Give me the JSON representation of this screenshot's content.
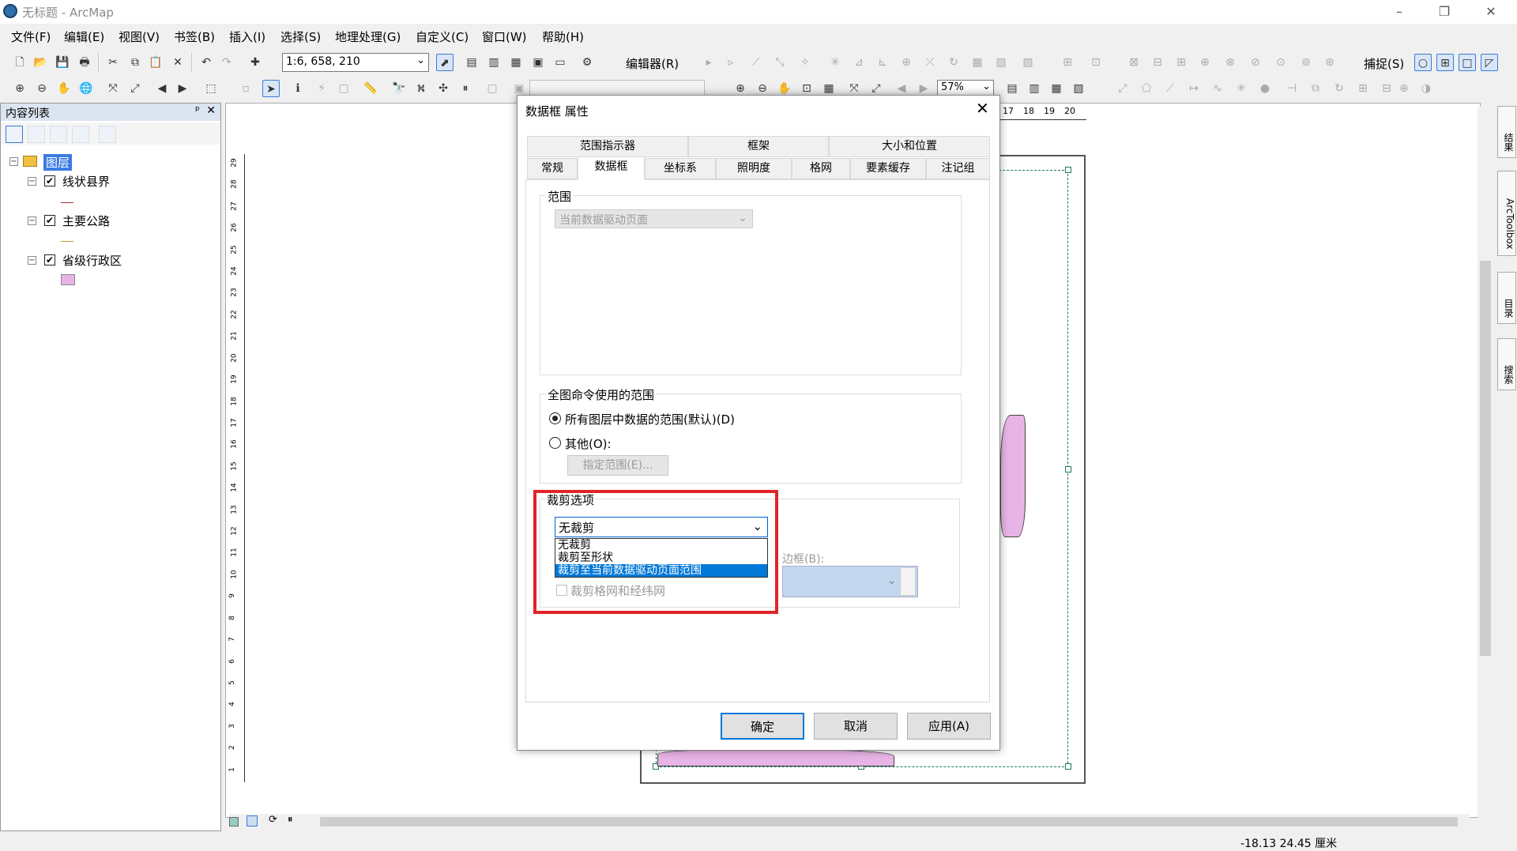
{
  "window": {
    "title": "无标题 - ArcMap",
    "minimize": "–",
    "restore": "❐",
    "close": "✕"
  },
  "menu": [
    "文件(F)",
    "编辑(E)",
    "视图(V)",
    "书签(B)",
    "插入(I)",
    "选择(S)",
    "地理处理(G)",
    "自定义(C)",
    "窗口(W)",
    "帮助(H)"
  ],
  "toolbar": {
    "scale": "1:6, 658, 210",
    "editor": "编辑器(R)",
    "snapping": "捕捉(S)",
    "zoom": "57%"
  },
  "toc": {
    "title": "内容列表",
    "pin": "ᵖ",
    "close": "✕",
    "root": "图层",
    "layers": [
      {
        "name": "线状县界",
        "checked": "✔"
      },
      {
        "name": "主要公路",
        "checked": "✔"
      },
      {
        "name": "省级行政区",
        "checked": "✔"
      }
    ],
    "expand_symbol": "−"
  },
  "ruler": {
    "vertical_ticks": [
      "29",
      "28",
      "27",
      "26",
      "25",
      "24",
      "23",
      "22",
      "21",
      "20",
      "19",
      "18",
      "17",
      "16",
      "15",
      "14",
      "13",
      "12",
      "11",
      "10",
      "9",
      "8",
      "7",
      "6",
      "5",
      "4",
      "3",
      "2",
      "1"
    ],
    "top_ticks": [
      "17",
      "18",
      "19",
      "20"
    ]
  },
  "side_tabs": [
    "结果",
    "ArcToolbox",
    "目录",
    "搜索"
  ],
  "status": {
    "coords": "-18.13  24.45 厘米"
  },
  "dialog": {
    "title": "数据框 属性",
    "close": "✕",
    "tabs_row1": [
      "范围指示器",
      "框架",
      "大小和位置"
    ],
    "tabs_row2": [
      "常规",
      "数据框",
      "坐标系",
      "照明度",
      "格网",
      "要素缓存",
      "注记组"
    ],
    "selected_tab": "数据框",
    "extent_group": {
      "label": "范围",
      "combo_value": "当前数据驱动页面"
    },
    "full_extent_group": {
      "label": "全图命令使用的范围",
      "option1": "所有图层中数据的范围(默认)(D)",
      "option2": "其他(O):",
      "specify_button": "指定范围(E)..."
    },
    "clip_group": {
      "label": "裁剪选项",
      "combo_value": "无裁剪",
      "options": [
        "无裁剪",
        "裁剪至形状",
        "裁剪至当前数据驱动页面范围"
      ],
      "highlighted_option": "裁剪至当前数据驱动页面范围",
      "border_label": "边框(B):",
      "clip_grids_label": "裁剪格网和经纬网"
    },
    "buttons": {
      "ok": "确定",
      "cancel": "取消",
      "apply": "应用(A)"
    }
  },
  "colors": {
    "highlight": "#0078d7",
    "annotation_red": "#e0242b",
    "polygon_fill": "#e8b4e6"
  }
}
